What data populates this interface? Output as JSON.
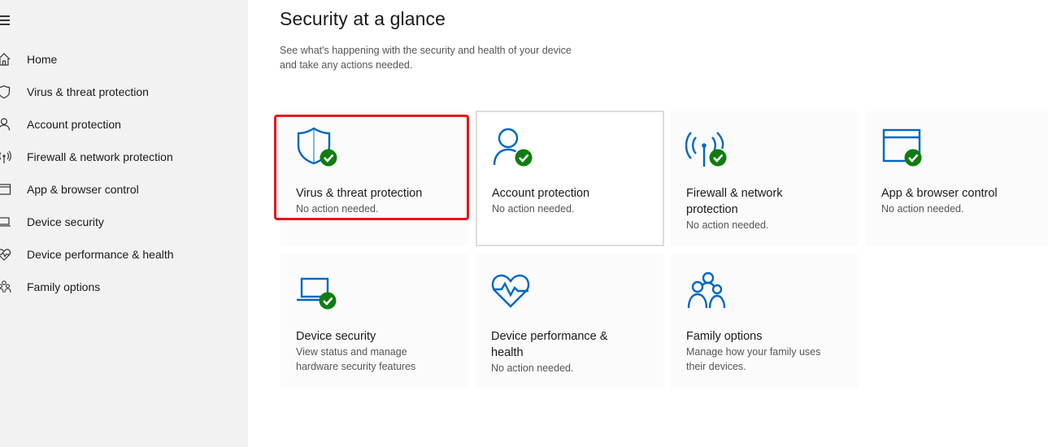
{
  "sidebar": {
    "items": [
      {
        "label": "Home",
        "icon": "home-icon"
      },
      {
        "label": "Virus & threat protection",
        "icon": "shield-icon"
      },
      {
        "label": "Account protection",
        "icon": "person-icon"
      },
      {
        "label": "Firewall & network protection",
        "icon": "antenna-icon"
      },
      {
        "label": "App & browser control",
        "icon": "browser-window-icon"
      },
      {
        "label": "Device security",
        "icon": "laptop-icon"
      },
      {
        "label": "Device performance & health",
        "icon": "heart-pulse-icon"
      },
      {
        "label": "Family options",
        "icon": "family-icon"
      }
    ]
  },
  "main": {
    "title": "Security at a glance",
    "subtitle_line1": "See what's happening with the security and health of your device",
    "subtitle_line2": "and take any actions needed.",
    "tiles": [
      {
        "title": "Virus & threat protection",
        "desc": "No action needed.",
        "icon": "shield-check-icon"
      },
      {
        "title": "Account protection",
        "desc": "No action needed.",
        "icon": "person-check-icon"
      },
      {
        "title_line1": "Firewall & network",
        "title_line2": "protection",
        "desc": "No action needed.",
        "icon": "antenna-check-icon"
      },
      {
        "title": "App & browser control",
        "desc": "No action needed.",
        "icon": "browser-check-icon"
      },
      {
        "title": "Device security",
        "desc_line1": "View status and manage",
        "desc_line2": "hardware security features",
        "icon": "laptop-check-icon"
      },
      {
        "title_line1": "Device performance &",
        "title_line2": "health",
        "desc": "No action needed.",
        "icon": "heart-pulse-icon"
      },
      {
        "title": "Family options",
        "desc_line1": "Manage how your family uses",
        "desc_line2": "their devices.",
        "icon": "family-icon"
      }
    ]
  },
  "colors": {
    "accent": "#0067c0",
    "status_ok": "#107c10",
    "highlight": "#e8141c",
    "sidebar_bg": "#f2f2f2"
  }
}
